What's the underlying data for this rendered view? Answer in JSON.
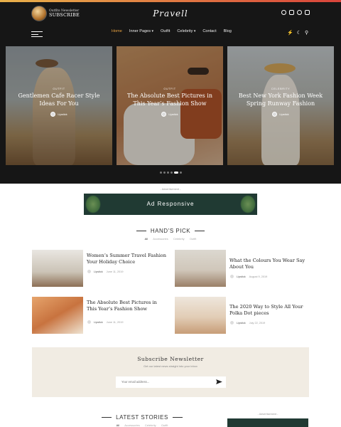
{
  "header": {
    "newsletter_small": "Outfits Newsletter",
    "newsletter_big": "SUBSCRIBE",
    "logo": "Pravell",
    "social_icons": [
      "pinterest-icon",
      "instagram-icon",
      "whatsapp-icon",
      "bookmark-icon"
    ]
  },
  "nav": {
    "items": [
      {
        "label": "Home",
        "active": true
      },
      {
        "label": "Inner Pages"
      },
      {
        "label": "Outfit"
      },
      {
        "label": "Celebrity"
      },
      {
        "label": "Contact"
      },
      {
        "label": "Blog"
      }
    ],
    "tools": [
      "bolt-icon",
      "moon-icon",
      "search-icon"
    ]
  },
  "slider": {
    "slides": [
      {
        "category": "Outfit",
        "title": "Gentlemen Cafe Racer Style Ideas For You",
        "author": "Lipstick"
      },
      {
        "category": "Outfit",
        "title": "The Absolute Best Pictures in This Year’s Fashion Show",
        "author": "Lipstick"
      },
      {
        "category": "Celebrity",
        "title": "Best New York Fashion Week Spring Runway Fashion",
        "author": "Lipstick"
      }
    ],
    "dots": 6,
    "active_dot": 4
  },
  "advertisement": {
    "label": "- Advertisement -",
    "banner": "Ad Responsive"
  },
  "hands_pick": {
    "title": "HAND’S PICK",
    "filters": [
      "All",
      "Accessories",
      "Celebrity",
      "Outfit"
    ],
    "posts": [
      {
        "title": "Women’s Summer Travel Fashion Your Holiday Choice",
        "author": "Lipstick",
        "date": "June 11, 2019"
      },
      {
        "title": "What the Colours You Wear Say About You",
        "author": "Lipstick",
        "date": "August 9, 2019"
      },
      {
        "title": "The Absolute Best Pictures in This Year’s Fashion Show",
        "author": "Lipstick",
        "date": "June 11, 2019"
      },
      {
        "title": "The 2020 Way to Style All Your Polka Dot pieces",
        "author": "Lipstick",
        "date": "July 22, 2019"
      }
    ]
  },
  "subscribe": {
    "title": "Subscribe Newsletter",
    "subtitle": "Get our latest news straight into your inbox",
    "placeholder": "Your email address...",
    "send_icon": "send-icon"
  },
  "latest": {
    "title": "LATEST STORIES",
    "filters": [
      "All",
      "Accessories",
      "Celebrity",
      "Outfit"
    ],
    "side_ad_label": "- Advertisement -"
  }
}
